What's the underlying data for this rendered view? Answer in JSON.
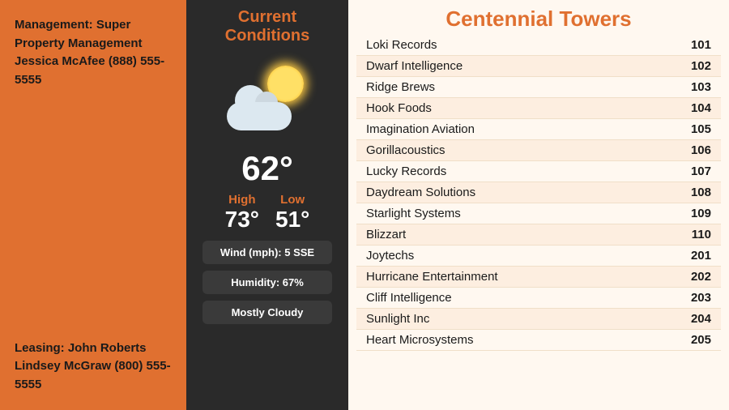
{
  "left": {
    "management_label": "Management: Super Property Management",
    "management_name": "Jessica McAfee (888) 555-5555",
    "leasing_label": "Leasing: John Roberts",
    "leasing_name": "Lindsey McGraw (800) 555-5555"
  },
  "weather": {
    "title": "Current Conditions",
    "temp": "62°",
    "high_label": "High",
    "high_value": "73°",
    "low_label": "Low",
    "low_value": "51°",
    "wind": "Wind (mph): 5 SSE",
    "humidity": "Humidity: 67%",
    "condition": "Mostly Cloudy"
  },
  "building": {
    "title": "Centennial Towers",
    "tenants": [
      {
        "name": "Loki Records",
        "suite": "101"
      },
      {
        "name": "Dwarf Intelligence",
        "suite": "102"
      },
      {
        "name": "Ridge Brews",
        "suite": "103"
      },
      {
        "name": "Hook Foods",
        "suite": "104"
      },
      {
        "name": "Imagination Aviation",
        "suite": "105"
      },
      {
        "name": "Gorillacoustics",
        "suite": "106"
      },
      {
        "name": "Lucky Records",
        "suite": "107"
      },
      {
        "name": "Daydream Solutions",
        "suite": "108"
      },
      {
        "name": "Starlight Systems",
        "suite": "109"
      },
      {
        "name": "Blizzart",
        "suite": "110"
      },
      {
        "name": "Joytechs",
        "suite": "201"
      },
      {
        "name": "Hurricane Entertainment",
        "suite": "202"
      },
      {
        "name": "Cliff Intelligence",
        "suite": "203"
      },
      {
        "name": "Sunlight Inc",
        "suite": "204"
      },
      {
        "name": "Heart Microsystems",
        "suite": "205"
      }
    ]
  }
}
